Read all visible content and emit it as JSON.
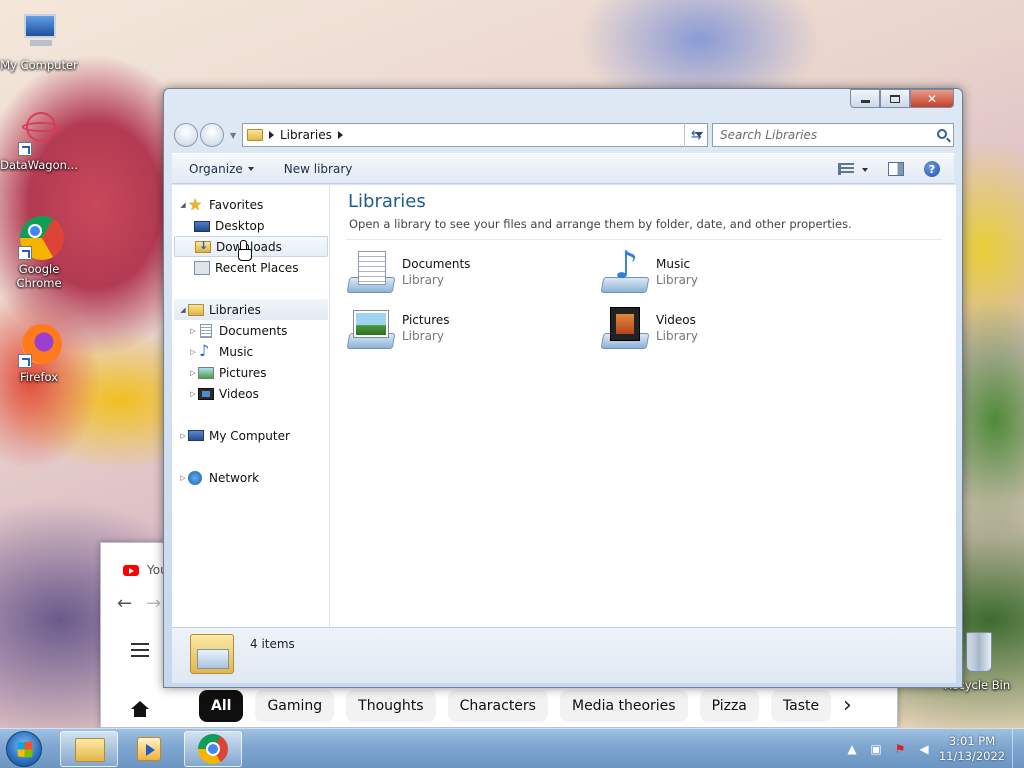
{
  "desktop": {
    "icons": [
      {
        "label": "My Computer"
      },
      {
        "label": "DataWagon..."
      },
      {
        "label": "Google Chrome"
      },
      {
        "label": "Firefox"
      },
      {
        "label": "Recycle Bin"
      }
    ]
  },
  "chrome_window": {
    "tab_title": "You",
    "chips": [
      "All",
      "Gaming",
      "Thoughts",
      "Characters",
      "Media theories",
      "Pizza",
      "Taste"
    ],
    "active_chip": "All"
  },
  "explorer": {
    "address": {
      "crumb": "Libraries",
      "search_placeholder": "Search Libraries"
    },
    "commands": {
      "organize": "Organize",
      "new_library": "New library"
    },
    "help_glyph": "?",
    "nav": {
      "favorites": "Favorites",
      "desktop": "Desktop",
      "downloads": "Downloads",
      "recent_places": "Recent Places",
      "libraries": "Libraries",
      "documents": "Documents",
      "music": "Music",
      "pictures": "Pictures",
      "videos": "Videos",
      "my_computer": "My Computer",
      "network": "Network"
    },
    "content": {
      "title": "Libraries",
      "subtitle": "Open a library to see your files and arrange them by folder, date, and other properties.",
      "items": [
        {
          "name": "Documents",
          "type": "Library",
          "icon": "documents-icon"
        },
        {
          "name": "Music",
          "type": "Library",
          "icon": "music-icon"
        },
        {
          "name": "Pictures",
          "type": "Library",
          "icon": "pictures-icon"
        },
        {
          "name": "Videos",
          "type": "Library",
          "icon": "videos-icon"
        }
      ]
    },
    "details": {
      "count": "4 items"
    }
  },
  "taskbar": {
    "clock": {
      "time": "3:01 PM",
      "date": "11/13/2022"
    }
  }
}
